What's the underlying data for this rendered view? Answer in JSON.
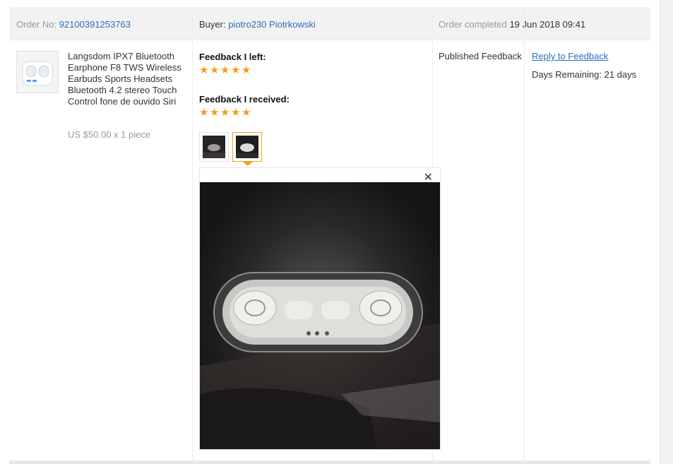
{
  "order": {
    "order_no_label": "Order No:",
    "order_no": "92100391253763",
    "buyer_label": "Buyer:",
    "buyer_name": "piotro230 Piotrkowski",
    "completed_label": "Order completed",
    "completed_date": "19 Jun 2018 09:41"
  },
  "product": {
    "title": "Langsdom IPX7 Bluetooth Earphone F8 TWS Wireless Earbuds Sports Headsets Bluetooth 4.2 stereo Touch Control fone de ouvido Siri",
    "price": "US $50.00 x 1 piece",
    "thumbnail_icon": "earbuds-product-image"
  },
  "feedback": {
    "left_label": "Feedback I left:",
    "left_rating": 5,
    "received_label": "Feedback I received:",
    "received_rating": 5,
    "star_color": "#f79a1b",
    "photos": [
      {
        "name": "photo-thumb-1",
        "active": false
      },
      {
        "name": "photo-thumb-2",
        "active": true
      }
    ],
    "viewer_close": "✕"
  },
  "status": {
    "text": "Published Feedback"
  },
  "actions": {
    "reply_label": "Reply to Feedback",
    "days_remaining": "Days Remaining: 21 days"
  }
}
